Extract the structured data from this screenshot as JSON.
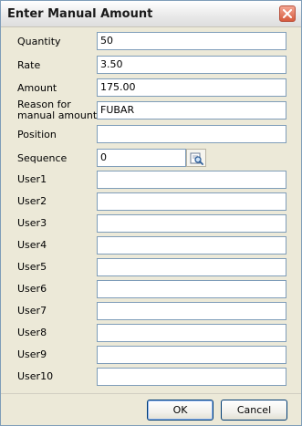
{
  "window": {
    "title": "Enter Manual Amount",
    "close_icon": "close-icon"
  },
  "fields": [
    {
      "label": "Quantity",
      "value": "50"
    },
    {
      "label": "Rate",
      "value": "3.50"
    },
    {
      "label": "Amount",
      "value": "175.00"
    },
    {
      "label_line1": "Reason for",
      "label_line2": "manual amount",
      "value": "FUBAR"
    },
    {
      "label": "Position",
      "value": ""
    },
    {
      "label": "Sequence",
      "value": "0",
      "icon": "lookup-icon"
    },
    {
      "label": "User1",
      "value": ""
    },
    {
      "label": "User2",
      "value": ""
    },
    {
      "label": "User3",
      "value": ""
    },
    {
      "label": "User4",
      "value": ""
    },
    {
      "label": "User5",
      "value": ""
    },
    {
      "label": "User6",
      "value": ""
    },
    {
      "label": "User7",
      "value": ""
    },
    {
      "label": "User8",
      "value": ""
    },
    {
      "label": "User9",
      "value": ""
    },
    {
      "label": "User10",
      "value": ""
    }
  ],
  "buttons": {
    "ok_label": "OK",
    "cancel_label": "Cancel"
  },
  "colors": {
    "dialog_bg": "#ece9d8",
    "input_border": "#7f9db9",
    "close_red": "#d65a3d"
  }
}
